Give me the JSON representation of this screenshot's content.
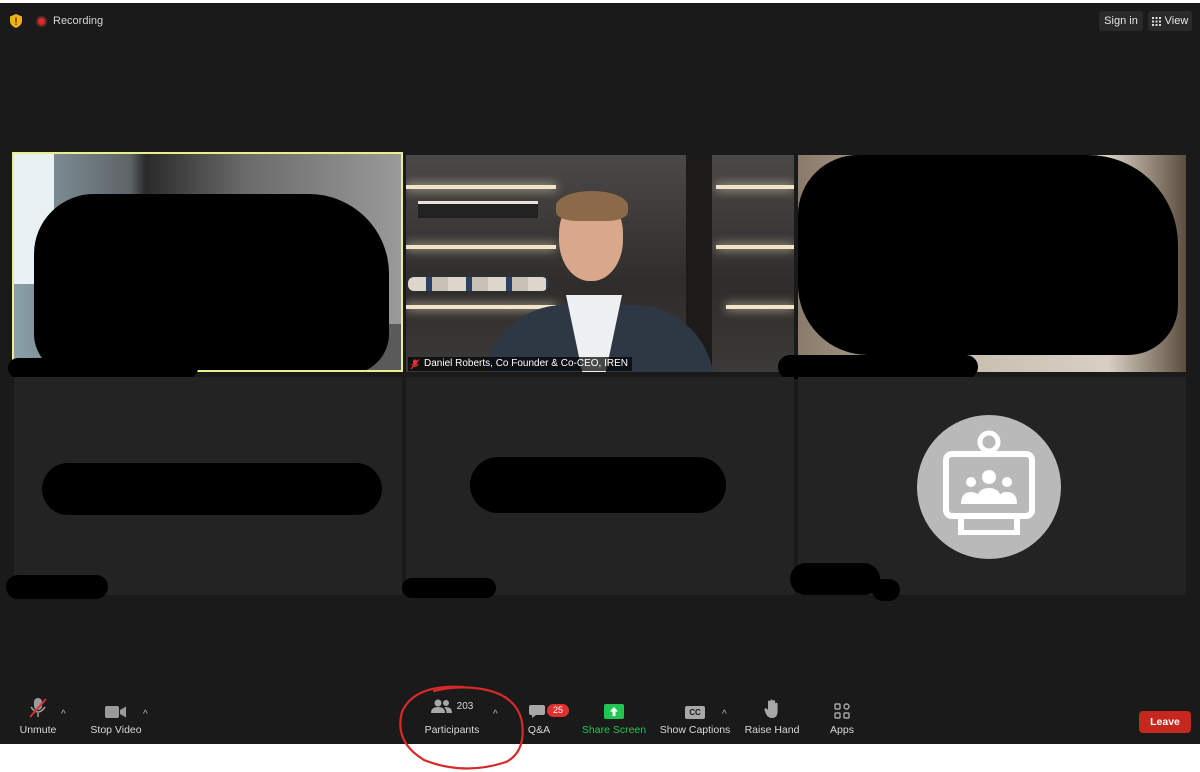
{
  "topbar": {
    "recording_label": "Recording",
    "signin_label": "Sign in",
    "view_label": "View"
  },
  "tiles": {
    "speaker_name": "Daniel Roberts, Co Founder & Co-CEO, IREN"
  },
  "toolbar": {
    "unmute_label": "Unmute",
    "stop_video_label": "Stop Video",
    "participants_count": "203",
    "participants_label": "Participants",
    "qa_label": "Q&A",
    "qa_badge": "25",
    "share_screen_label": "Share Screen",
    "show_captions_label": "Show Captions",
    "captions_icon_text": "CC",
    "raise_hand_label": "Raise Hand",
    "apps_label": "Apps",
    "leave_label": "Leave"
  },
  "colors": {
    "accent_green": "#23c552",
    "leave_red": "#c6281f",
    "active_speaker_border": "#e8f08a",
    "annotation_red": "#d62a2a"
  }
}
